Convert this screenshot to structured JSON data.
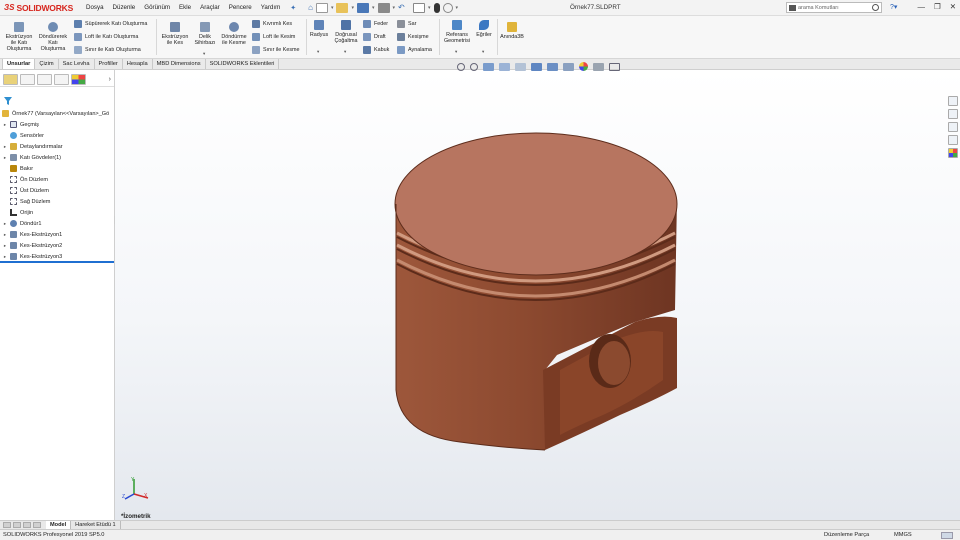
{
  "app": {
    "brand": "SOLIDWORKS",
    "document_title": "Örnek77.SLDPRT",
    "search_placeholder": "arama Komutları"
  },
  "menu": [
    "Dosya",
    "Düzenle",
    "Görünüm",
    "Ekle",
    "Araçlar",
    "Pencere",
    "Yardım"
  ],
  "ribbon": {
    "extrude_boss": "Ekstrüzyon ile Katı Oluşturma",
    "revolve_boss": "Döndürerek Katı Oluşturma",
    "swept_boss": "Süpürerek Katı Oluşturma",
    "loft_boss": "Loft ile Katı Oluşturma",
    "boundary_boss": "Sınır ile Katı Oluşturma",
    "extrude_cut": "Ekstrüzyon ile Kes",
    "hole_wizard": "Delik Sihirbazı",
    "revolve_cut": "Döndürme ile Kesme",
    "swept_cut": "Kıvrımlı Kes",
    "loft_cut": "Loft ile Kesim",
    "boundary_cut": "Sınır ile Kesme",
    "fillet": "Radyus",
    "linear_pattern": "Doğrusal Çoğaltma",
    "rib": "Feder",
    "draft": "Draft",
    "shell": "Kabuk",
    "wrap": "Sar",
    "intersect": "Kesişme",
    "mirror": "Aynalama",
    "reference_geometry": "Referans Geometrisi",
    "curves": "Eğriler",
    "instant3d": "Anında3B"
  },
  "tabs": [
    "Unsurlar",
    "Çizim",
    "Sac Levha",
    "Profiller",
    "Hesapla",
    "MBD Dimensions",
    "SOLIDWORKS Eklentileri"
  ],
  "tree": {
    "root": "Örnek77  (Varsayılan<<Varsayılan>_Gö",
    "items": [
      {
        "label": "Geçmiş",
        "exp": "▸"
      },
      {
        "label": "Sensörler",
        "exp": ""
      },
      {
        "label": "Detaylandırmalar",
        "exp": "▸"
      },
      {
        "label": "Katı Gövdeler(1)",
        "exp": "▸"
      },
      {
        "label": "Bakır",
        "exp": ""
      },
      {
        "label": "Ön Düzlem",
        "exp": ""
      },
      {
        "label": "Üst Düzlem",
        "exp": ""
      },
      {
        "label": "Sağ Düzlem",
        "exp": ""
      },
      {
        "label": "Orijin",
        "exp": ""
      },
      {
        "label": "Döndür1",
        "exp": "▸"
      },
      {
        "label": "Kes-Ekstrüzyon1",
        "exp": "▸"
      },
      {
        "label": "Kes-Ekstrüzyon2",
        "exp": "▸"
      },
      {
        "label": "Kes-Ekstrüzyon3",
        "exp": "▸"
      }
    ]
  },
  "viewport": {
    "view_name": "*İzometrik"
  },
  "bottom_tabs": [
    "Model",
    "Hareket Etüdü 1"
  ],
  "status": {
    "version": "SOLIDWORKS Profesyonel 2019 SP5.0",
    "mode": "Düzenleme Parça",
    "units": "MMGS"
  },
  "colors": {
    "brand_red": "#d7261e",
    "copper_top": "#b97a62",
    "copper_side": "#8f4a31",
    "selection_blue": "#1f6fd1"
  }
}
